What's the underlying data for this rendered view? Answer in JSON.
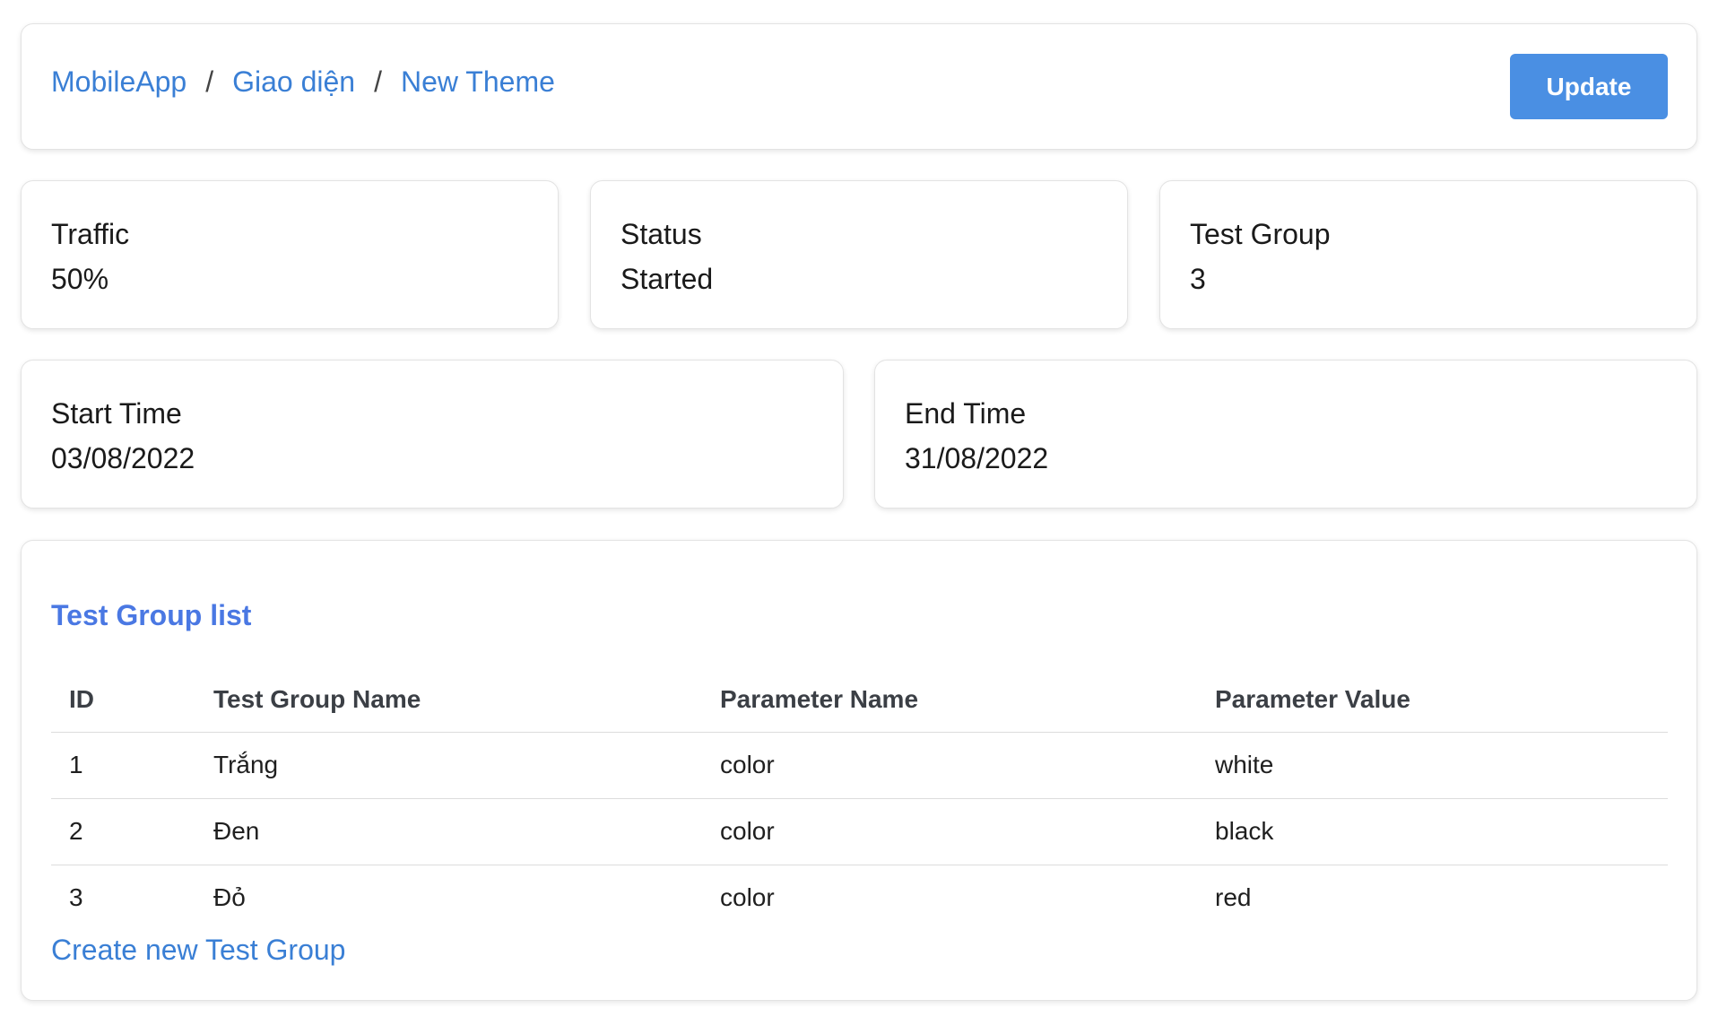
{
  "breadcrumb": {
    "items": [
      "MobileApp",
      "Giao diện",
      "New Theme"
    ],
    "separator": "/"
  },
  "header": {
    "update_label": "Update"
  },
  "stats": {
    "traffic": {
      "label": "Traffic",
      "value": "50%"
    },
    "status": {
      "label": "Status",
      "value": "Started"
    },
    "test_group": {
      "label": "Test Group",
      "value": "3"
    },
    "start_time": {
      "label": "Start Time",
      "value": "03/08/2022"
    },
    "end_time": {
      "label": "End Time",
      "value": "31/08/2022"
    }
  },
  "test_groups": {
    "title": "Test Group list",
    "columns": [
      "ID",
      "Test Group Name",
      "Parameter Name",
      "Parameter Value"
    ],
    "rows": [
      [
        "1",
        "Trắng",
        "color",
        "white"
      ],
      [
        "2",
        "Đen",
        "color",
        "black"
      ],
      [
        "3",
        "Đỏ",
        "color",
        "red"
      ]
    ],
    "create_label": "Create new Test Group"
  },
  "colors": {
    "link": "#3a7fd5",
    "button": "#4a8fe3",
    "section_title": "#4a78e3"
  }
}
